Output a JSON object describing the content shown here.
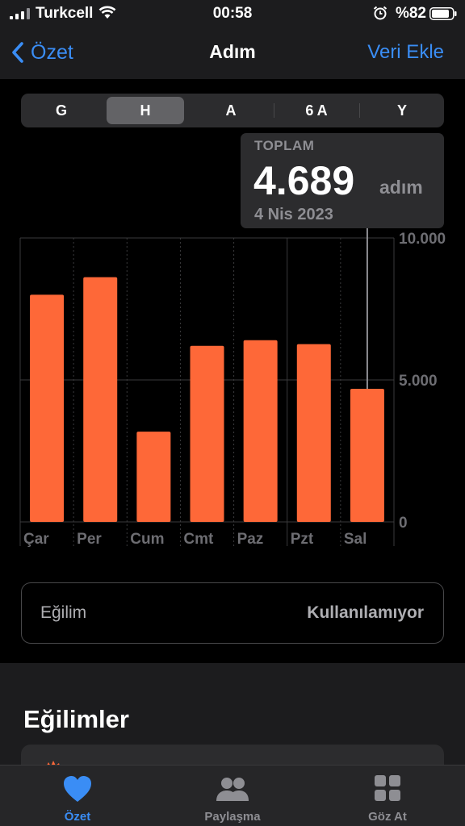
{
  "status_bar": {
    "carrier": "Turkcell",
    "time": "00:58",
    "battery": "%82"
  },
  "nav": {
    "back_label": "Özet",
    "title": "Adım",
    "action_label": "Veri Ekle"
  },
  "segments": {
    "items": [
      "G",
      "H",
      "A",
      "6 A",
      "Y"
    ],
    "selected": "H"
  },
  "tooltip": {
    "label": "TOPLAM",
    "value": "4.689",
    "unit": "adım",
    "date": "4 Nis 2023"
  },
  "chart_data": {
    "type": "bar",
    "categories": [
      "Çar",
      "Per",
      "Cum",
      "Cmt",
      "Paz",
      "Pzt",
      "Sal"
    ],
    "values": [
      8000,
      8620,
      3180,
      6200,
      6400,
      6260,
      4689
    ],
    "ylim": [
      0,
      10000
    ],
    "yticks": [
      "10.000",
      "5.000",
      "0"
    ],
    "ytick_values": [
      10000,
      5000,
      0
    ],
    "selected_index": 6,
    "colors": {
      "bar": "#fe6838",
      "grid": "#3a3a3c",
      "axis_text": "#6d6d72",
      "selection_line": "#8e8e93"
    }
  },
  "trend_row": {
    "label": "Eğilim",
    "value": "Kullanılamıyor"
  },
  "section": {
    "title": "Eğilimler"
  },
  "tabbar": {
    "items": [
      {
        "label": "Özet",
        "icon": "heart-icon"
      },
      {
        "label": "Paylaşma",
        "icon": "people-icon"
      },
      {
        "label": "Göz At",
        "icon": "grid-icon"
      }
    ],
    "selected": "Özet"
  },
  "colors": {
    "accent": "#3a8df5",
    "bar": "#fe6838",
    "background": "#000000"
  }
}
